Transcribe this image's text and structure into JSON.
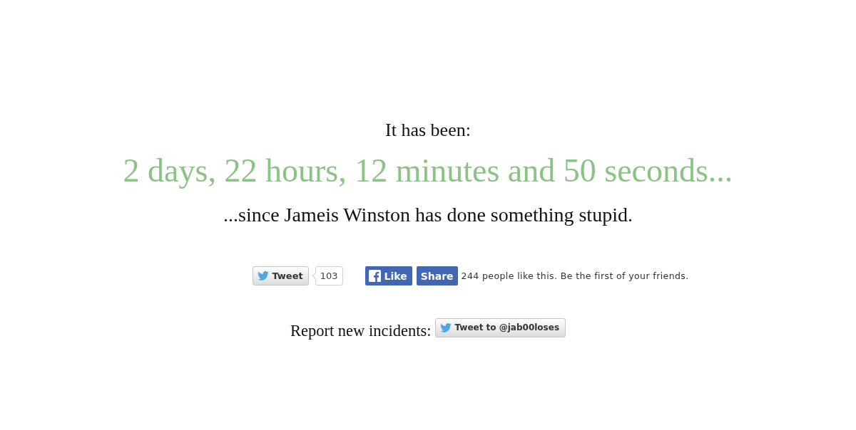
{
  "heading": "It has been:",
  "elapsed": "2 days, 22 hours, 12 minutes and 50 seconds...",
  "subtitle": "...since Jameis Winston has done something stupid.",
  "share_bar": {
    "tweet_button": {
      "label": "Tweet",
      "count": "103"
    },
    "like_button": {
      "label": "Like"
    },
    "share_button": {
      "label": "Share"
    },
    "like_summary": "244 people like this. Be the first of your friends."
  },
  "report": {
    "label": "Report new incidents:",
    "tweet_to_button": {
      "label": "Tweet to @jab00loses"
    }
  }
}
